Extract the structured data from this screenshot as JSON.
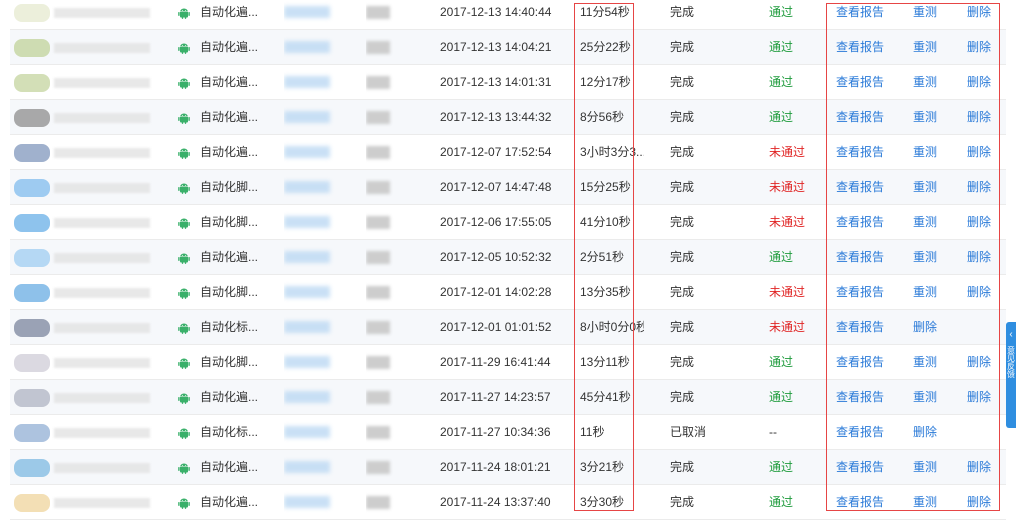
{
  "rows": [
    {
      "name": "自动化遍...",
      "time": "2017-12-13 14:40:44",
      "duration": "11分54秒",
      "status": "完成",
      "result": "通过",
      "result_type": "pass",
      "actions": [
        "查看报告",
        "重测",
        "删除"
      ],
      "thumb_color": "#e9ecd5"
    },
    {
      "name": "自动化遍...",
      "time": "2017-12-13 14:04:21",
      "duration": "25分22秒",
      "status": "完成",
      "result": "通过",
      "result_type": "pass",
      "actions": [
        "查看报告",
        "重测",
        "删除"
      ],
      "thumb_color": "#c7d7a4"
    },
    {
      "name": "自动化遍...",
      "time": "2017-12-13 14:01:31",
      "duration": "12分17秒",
      "status": "完成",
      "result": "通过",
      "result_type": "pass",
      "actions": [
        "查看报告",
        "重测",
        "删除"
      ],
      "thumb_color": "#cbd9aa"
    },
    {
      "name": "自动化遍...",
      "time": "2017-12-13 13:44:32",
      "duration": "8分56秒",
      "status": "完成",
      "result": "通过",
      "result_type": "pass",
      "actions": [
        "查看报告",
        "重测",
        "删除"
      ],
      "thumb_color": "#9a9a9a"
    },
    {
      "name": "自动化遍...",
      "time": "2017-12-07 17:52:54",
      "duration": "3小时3分3...",
      "status": "完成",
      "result": "未通过",
      "result_type": "fail",
      "actions": [
        "查看报告",
        "重测",
        "删除"
      ],
      "thumb_color": "#8fa3c4"
    },
    {
      "name": "自动化脚...",
      "time": "2017-12-07 14:47:48",
      "duration": "15分25秒",
      "status": "完成",
      "result": "未通过",
      "result_type": "fail",
      "actions": [
        "查看报告",
        "重测",
        "删除"
      ],
      "thumb_color": "#8ec3ee"
    },
    {
      "name": "自动化脚...",
      "time": "2017-12-06 17:55:05",
      "duration": "41分10秒",
      "status": "完成",
      "result": "未通过",
      "result_type": "fail",
      "actions": [
        "查看报告",
        "重测",
        "删除"
      ],
      "thumb_color": "#7ab8ea"
    },
    {
      "name": "自动化遍...",
      "time": "2017-12-05 10:52:32",
      "duration": "2分51秒",
      "status": "完成",
      "result": "通过",
      "result_type": "pass",
      "actions": [
        "查看报告",
        "重测",
        "删除"
      ],
      "thumb_color": "#a9d2f2"
    },
    {
      "name": "自动化脚...",
      "time": "2017-12-01 14:02:28",
      "duration": "13分35秒",
      "status": "完成",
      "result": "未通过",
      "result_type": "fail",
      "actions": [
        "查看报告",
        "重测",
        "删除"
      ],
      "thumb_color": "#7ab6e6"
    },
    {
      "name": "自动化标...",
      "time": "2017-12-01 01:01:52",
      "duration": "8小时0分0秒",
      "status": "完成",
      "result": "未通过",
      "result_type": "fail",
      "actions": [
        "查看报告",
        "删除"
      ],
      "thumb_color": "#8a93a8"
    },
    {
      "name": "自动化脚...",
      "time": "2017-11-29 16:41:44",
      "duration": "13分11秒",
      "status": "完成",
      "result": "通过",
      "result_type": "pass",
      "actions": [
        "查看报告",
        "重测",
        "删除"
      ],
      "thumb_color": "#d5d2dc"
    },
    {
      "name": "自动化遍...",
      "time": "2017-11-27 14:23:57",
      "duration": "45分41秒",
      "status": "完成",
      "result": "通过",
      "result_type": "pass",
      "actions": [
        "查看报告",
        "重测",
        "删除"
      ],
      "thumb_color": "#b7bcc9"
    },
    {
      "name": "自动化标...",
      "time": "2017-11-27 10:34:36",
      "duration": "11秒",
      "status": "已取消",
      "result": "--",
      "result_type": "none",
      "actions": [
        "查看报告",
        "删除"
      ],
      "thumb_color": "#9fb9d9"
    },
    {
      "name": "自动化遍...",
      "time": "2017-11-24 18:01:21",
      "duration": "3分21秒",
      "status": "完成",
      "result": "通过",
      "result_type": "pass",
      "actions": [
        "查看报告",
        "重测",
        "删除"
      ],
      "thumb_color": "#8cc1e4"
    },
    {
      "name": "自动化遍...",
      "time": "2017-11-24 13:37:40",
      "duration": "3分30秒",
      "status": "完成",
      "result": "通过",
      "result_type": "pass",
      "actions": [
        "查看报告",
        "重测",
        "删除"
      ],
      "thumb_color": "#f1d9a8"
    }
  ],
  "icons": {
    "platform": "android-icon",
    "side_tab": "chevron-left-icon"
  },
  "colors": {
    "pass": "#1e9b3c",
    "fail": "#e02424",
    "link": "#2a7ad8",
    "highlight": "#e64545",
    "side_tab": "#2f8ee0"
  },
  "side_tab": {
    "chevron": "‹",
    "text": "意见反馈"
  }
}
